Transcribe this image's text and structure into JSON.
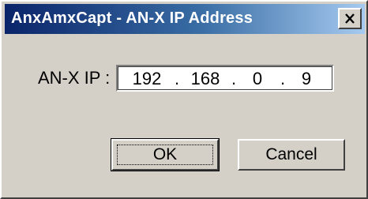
{
  "window": {
    "title": "AnxAmxCapt - AN-X IP Address",
    "close_icon": "close-icon"
  },
  "form": {
    "ip_label": "AN-X IP :",
    "ip_octets": [
      "192",
      "168",
      "0",
      "9"
    ],
    "separator": "."
  },
  "buttons": {
    "ok_label": "OK",
    "cancel_label": "Cancel"
  },
  "colors": {
    "titlebar_start": "#0a246a",
    "titlebar_end": "#a6caf0",
    "dialog_face": "#d4d0c8"
  }
}
